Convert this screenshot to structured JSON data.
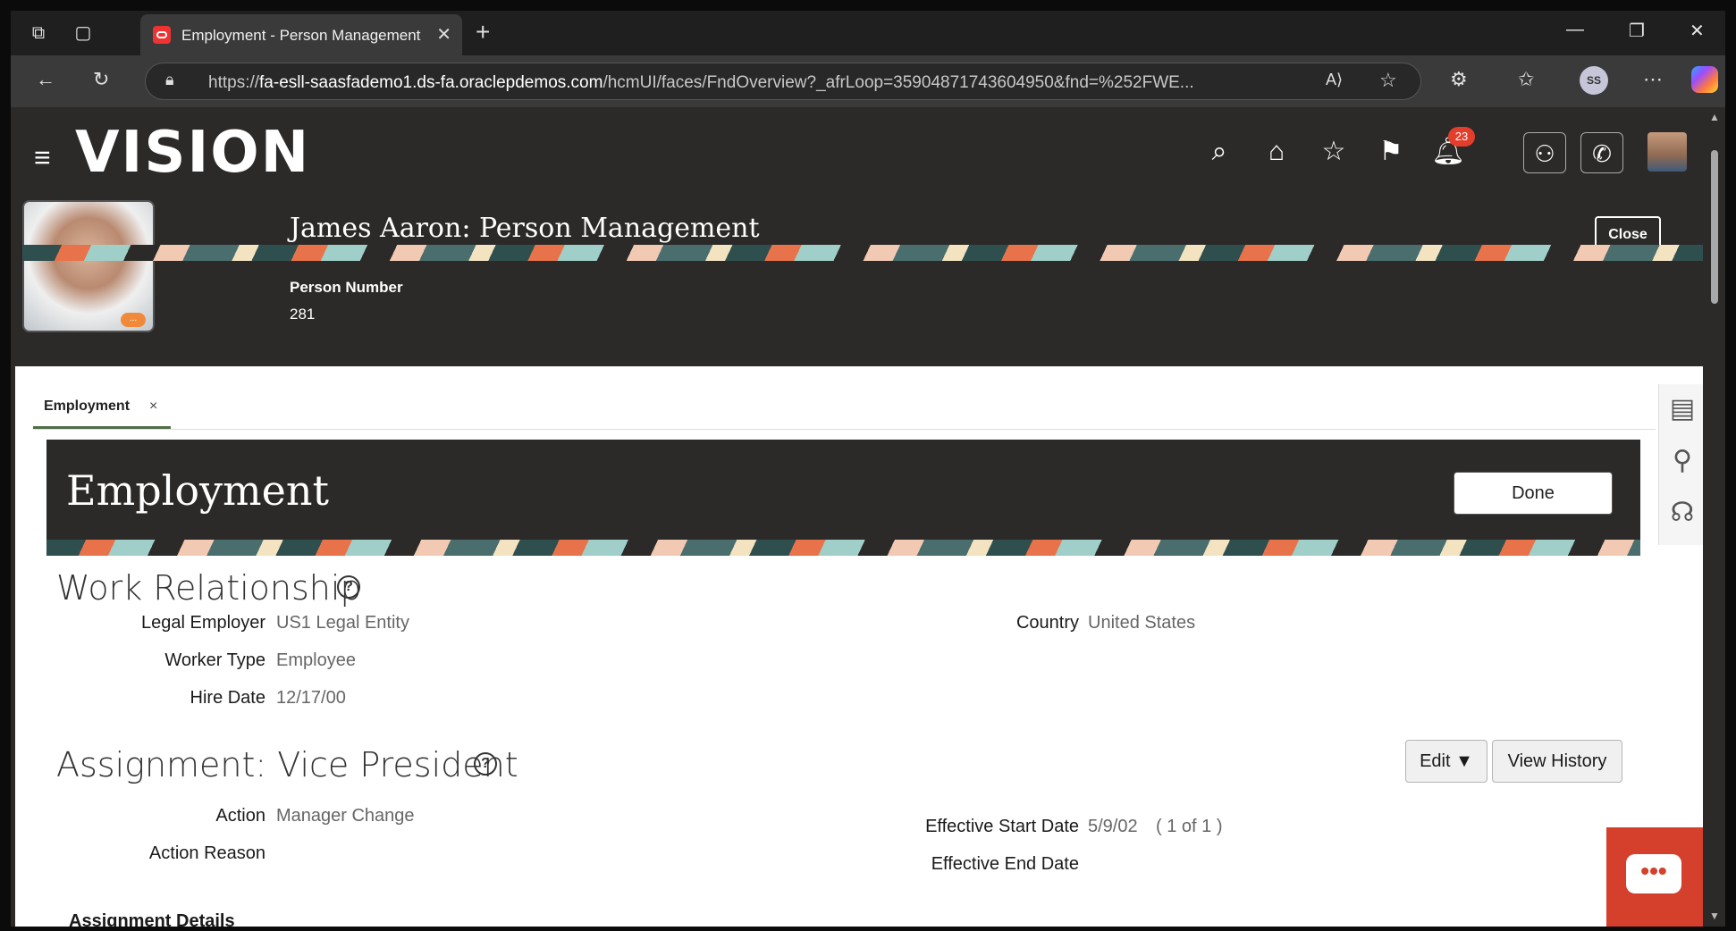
{
  "browser": {
    "tab_title": "Employment - Person Management",
    "tab_close": "✕",
    "new_tab": "+",
    "url_prefix": "https://",
    "url_host": "fa-esll-saasfademo1.ds-fa.oraclepdemos.com",
    "url_path": "/hcmUI/faces/FndOverview?_afrLoop=35904871743604950&fnd=%252FWE...",
    "profile_initials": "SS"
  },
  "app": {
    "logo": "VISION",
    "notifications_count": "23",
    "person_title": "James Aaron: Person Management",
    "person_number_label": "Person Number",
    "person_number": "281",
    "close_label": "Close",
    "photo_badge": "..."
  },
  "tabs": [
    {
      "label": "Employment",
      "close": "×"
    }
  ],
  "employment": {
    "title": "Employment",
    "done_label": "Done"
  },
  "work_relationship": {
    "title": "Work Relationship",
    "fields": {
      "legal_employer_label": "Legal Employer",
      "legal_employer": "US1 Legal Entity",
      "worker_type_label": "Worker Type",
      "worker_type": "Employee",
      "hire_date_label": "Hire Date",
      "hire_date": "12/17/00",
      "country_label": "Country",
      "country": "United States"
    }
  },
  "assignment": {
    "title": "Assignment: Vice President",
    "edit_label": "Edit",
    "view_history_label": "View History",
    "action_label": "Action",
    "action": "Manager Change",
    "action_reason_label": "Action Reason",
    "effective_start_label": "Effective Start Date",
    "effective_start": "5/9/02",
    "record_counter": "( 1 of 1 )",
    "effective_end_label": "Effective End Date",
    "details_label": "Assignment Details"
  },
  "icons": {
    "help": "?",
    "chat": "•••"
  }
}
